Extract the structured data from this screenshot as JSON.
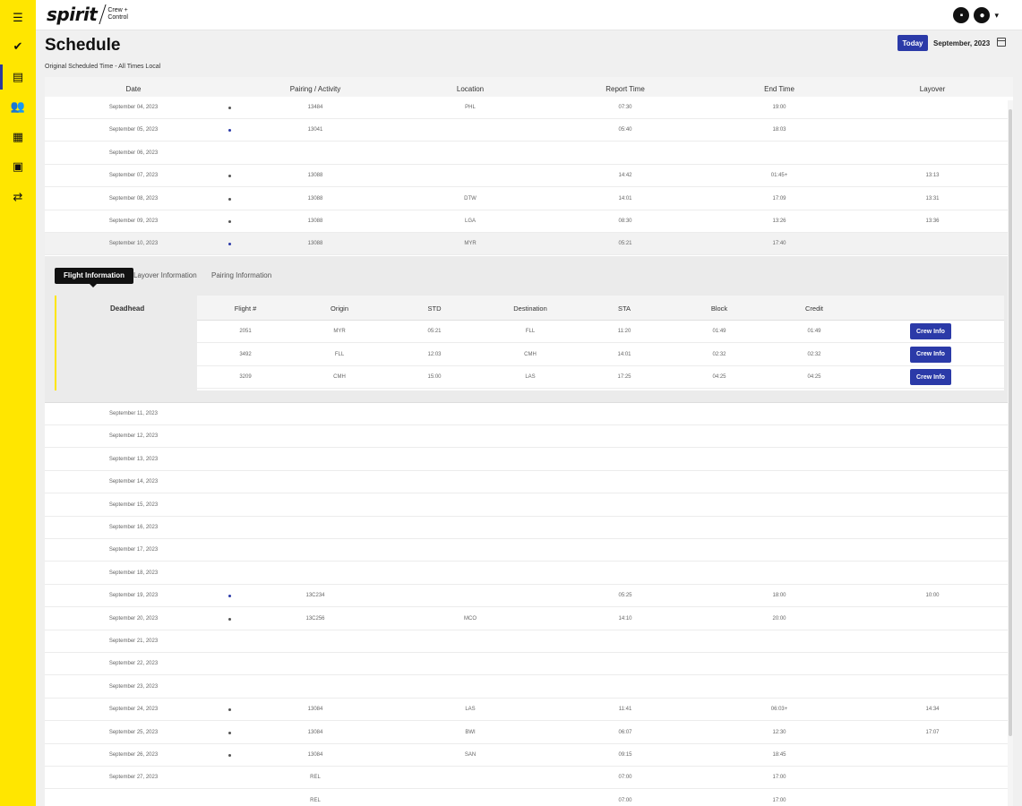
{
  "sidebar": {
    "items": [
      {
        "name": "menu-icon",
        "glyph": "☰"
      },
      {
        "name": "check-circle-icon",
        "glyph": "✔"
      },
      {
        "name": "calendar-icon",
        "glyph": "▤"
      },
      {
        "name": "people-icon",
        "glyph": "👥"
      },
      {
        "name": "document-icon",
        "glyph": "▦"
      },
      {
        "name": "bus-icon",
        "glyph": "▣"
      },
      {
        "name": "handshake-icon",
        "glyph": "⇄"
      }
    ],
    "bg_color": "#ffe600"
  },
  "header": {
    "logo_text": "spirit",
    "logo_sub": "Crew + Control"
  },
  "page": {
    "title": "Schedule",
    "subtitle": "Original Scheduled Time - All Times Local",
    "today_label": "Today",
    "month_label": "September, 2023"
  },
  "table": {
    "headers": [
      "Date",
      "Pairing / Activity",
      "Location",
      "Report Time",
      "End Time",
      "Layover"
    ],
    "rows_top": [
      {
        "date": "September 04, 2023",
        "dot": "gray",
        "pairing": "13484",
        "location": "PHL",
        "report": "07:30",
        "end": "19:00",
        "layover": ""
      },
      {
        "date": "September 05, 2023",
        "dot": "blue",
        "pairing": "13041",
        "location": "",
        "report": "05:40",
        "end": "18:03",
        "layover": ""
      },
      {
        "date": "September 06, 2023",
        "dot": "",
        "pairing": "",
        "location": "",
        "report": "",
        "end": "",
        "layover": ""
      },
      {
        "date": "September 07, 2023",
        "dot": "gray",
        "pairing": "13088",
        "location": "",
        "report": "14:42",
        "end": "01:45+",
        "layover": "13:13"
      },
      {
        "date": "September 08, 2023",
        "dot": "gray",
        "pairing": "13088",
        "location": "DTW",
        "report": "14:01",
        "end": "17:09",
        "layover": "13:31"
      },
      {
        "date": "September 09, 2023",
        "dot": "gray",
        "pairing": "13088",
        "location": "LGA",
        "report": "08:30",
        "end": "13:26",
        "layover": "13:36"
      },
      {
        "date": "September 10, 2023",
        "dot": "blue",
        "pairing": "13088",
        "location": "MYR",
        "report": "05:21",
        "end": "17:40",
        "layover": ""
      }
    ],
    "rows_bottom": [
      {
        "date": "September 11, 2023",
        "dot": "",
        "pairing": "",
        "location": "",
        "report": "",
        "end": "",
        "layover": ""
      },
      {
        "date": "September 12, 2023",
        "dot": "",
        "pairing": "",
        "location": "",
        "report": "",
        "end": "",
        "layover": ""
      },
      {
        "date": "September 13, 2023",
        "dot": "",
        "pairing": "",
        "location": "",
        "report": "",
        "end": "",
        "layover": ""
      },
      {
        "date": "September 14, 2023",
        "dot": "",
        "pairing": "",
        "location": "",
        "report": "",
        "end": "",
        "layover": ""
      },
      {
        "date": "September 15, 2023",
        "dot": "",
        "pairing": "",
        "location": "",
        "report": "",
        "end": "",
        "layover": ""
      },
      {
        "date": "September 16, 2023",
        "dot": "",
        "pairing": "",
        "location": "",
        "report": "",
        "end": "",
        "layover": ""
      },
      {
        "date": "September 17, 2023",
        "dot": "",
        "pairing": "",
        "location": "",
        "report": "",
        "end": "",
        "layover": ""
      },
      {
        "date": "September 18, 2023",
        "dot": "",
        "pairing": "",
        "location": "",
        "report": "",
        "end": "",
        "layover": ""
      },
      {
        "date": "September 19, 2023",
        "dot": "blue",
        "pairing": "13C234",
        "location": "",
        "report": "05:25",
        "end": "18:00",
        "layover": "10:00"
      },
      {
        "date": "September 20, 2023",
        "dot": "gray",
        "pairing": "13C256",
        "location": "MCO",
        "report": "14:10",
        "end": "20:00",
        "layover": ""
      },
      {
        "date": "September 21, 2023",
        "dot": "",
        "pairing": "",
        "location": "",
        "report": "",
        "end": "",
        "layover": ""
      },
      {
        "date": "September 22, 2023",
        "dot": "",
        "pairing": "",
        "location": "",
        "report": "",
        "end": "",
        "layover": ""
      },
      {
        "date": "September 23, 2023",
        "dot": "",
        "pairing": "",
        "location": "",
        "report": "",
        "end": "",
        "layover": ""
      },
      {
        "date": "September 24, 2023",
        "dot": "gray",
        "pairing": "13084",
        "location": "LAS",
        "report": "11:41",
        "end": "06:03+",
        "layover": "14:34"
      },
      {
        "date": "September 25, 2023",
        "dot": "gray",
        "pairing": "13084",
        "location": "BWI",
        "report": "06:07",
        "end": "12:30",
        "layover": "17:07"
      },
      {
        "date": "September 26, 2023",
        "dot": "gray",
        "pairing": "13084",
        "location": "SAN",
        "report": "09:15",
        "end": "18:45",
        "layover": ""
      },
      {
        "date": "September 27, 2023",
        "dot": "",
        "pairing": "REL",
        "location": "",
        "report": "07:00",
        "end": "17:00",
        "layover": ""
      },
      {
        "date": "",
        "dot": "",
        "pairing": "REL",
        "location": "",
        "report": "07:00",
        "end": "17:00",
        "layover": ""
      }
    ]
  },
  "detail": {
    "tabs": [
      "Flight Information",
      "Layover Information",
      "Pairing Information"
    ],
    "deadhead_label": "Deadhead",
    "flight_headers": [
      "Flight #",
      "Origin",
      "STD",
      "Destination",
      "STA",
      "Block",
      "Credit"
    ],
    "flights": [
      {
        "flight": "2051",
        "origin": "MYR",
        "std": "05:21",
        "dest": "FLL",
        "sta": "11:20",
        "block": "01:49",
        "credit": "01:49",
        "btn": "Crew Info"
      },
      {
        "flight": "3492",
        "origin": "FLL",
        "std": "12:03",
        "dest": "CMH",
        "sta": "14:01",
        "block": "02:32",
        "credit": "02:32",
        "btn": "Crew Info"
      },
      {
        "flight": "3209",
        "origin": "CMH",
        "std": "15:00",
        "dest": "LAS",
        "sta": "17:25",
        "block": "04:25",
        "credit": "04:25",
        "btn": "Crew Info"
      }
    ]
  },
  "colors": {
    "accent": "#2b3aa8",
    "brand_yellow": "#ffe600"
  }
}
